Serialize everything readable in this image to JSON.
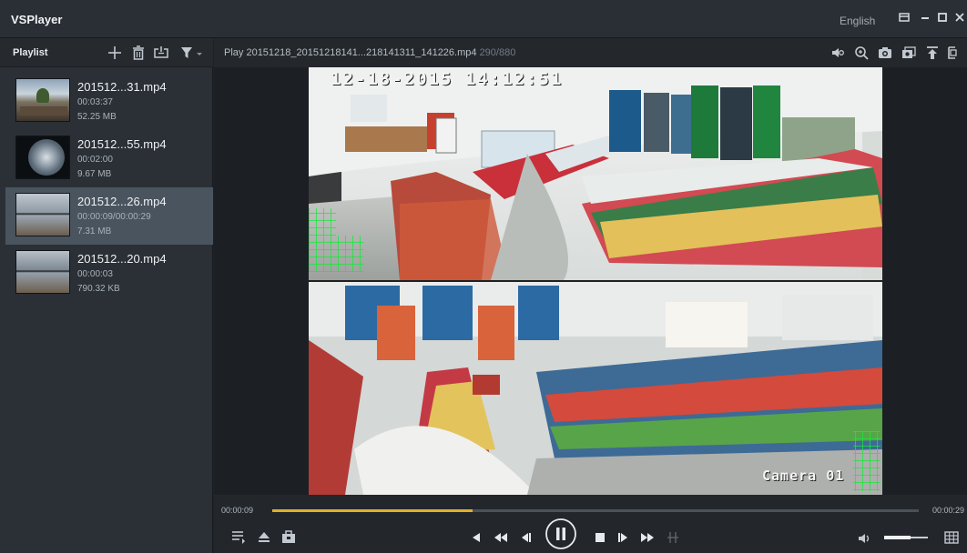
{
  "window": {
    "title": "VSPlayer",
    "language": "English",
    "buttons": [
      "restore-icon",
      "minimize-icon",
      "maximize-icon",
      "close-icon"
    ]
  },
  "playlist": {
    "title": "Playlist",
    "tools": [
      "add-icon",
      "delete-icon",
      "loop-icon",
      "filter-icon"
    ],
    "items": [
      {
        "name": "201512...31.mp4",
        "duration": "00:03:37",
        "size": "52.25 MB",
        "active": false
      },
      {
        "name": "201512...55.mp4",
        "duration": "00:02:00",
        "size": "9.67 MB",
        "active": false
      },
      {
        "name": "201512...26.mp4",
        "duration": "00:00:09/00:00:29",
        "size": "7.31 MB",
        "active": true
      },
      {
        "name": "201512...20.mp4",
        "duration": "00:00:03",
        "size": "790.32 KB",
        "active": false
      }
    ]
  },
  "header": {
    "play_label": "Play 20151218_20151218141...218141311_141226.mp4",
    "frame_count": "290/880",
    "tools": [
      "audio-icon",
      "zoom-icon",
      "snapshot-icon",
      "burst-snapshot-icon",
      "pin-top-icon",
      "fullscreen-icon"
    ]
  },
  "video": {
    "osd_time": "12-18-2015 14:12:51",
    "camera_label": "Camera 01"
  },
  "controls": {
    "current_time": "00:00:09",
    "total_time": "00:00:29",
    "progress": 0.31,
    "volume": 0.6,
    "left_tools": [
      "playlist-icon",
      "eject-icon",
      "toolbox-icon"
    ],
    "transport": [
      "stop-icon",
      "slow-icon",
      "step-back-icon",
      "pause-icon",
      "stop-square-icon",
      "step-forward-icon",
      "fast-icon",
      "clip-icon"
    ],
    "right_tools": [
      "volume-icon",
      "layout-grid-icon"
    ]
  },
  "colors": {
    "accent": "#e0b128",
    "motion_grid": "#18e83a",
    "background": "#1e2226"
  }
}
